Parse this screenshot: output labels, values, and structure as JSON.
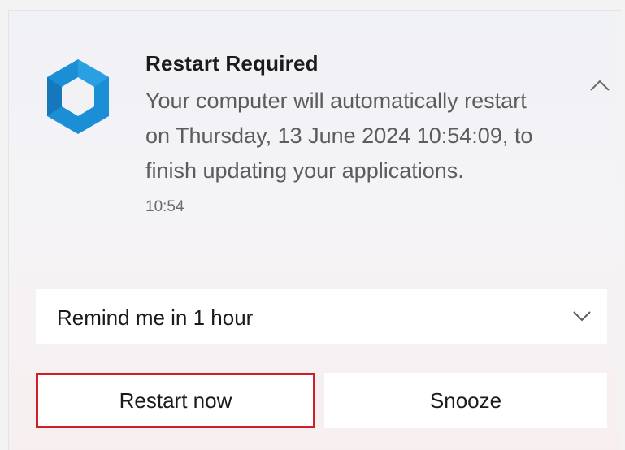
{
  "notification": {
    "title": "Restart Required",
    "message": "Your computer will automatically restart on  Thursday, 13 June 2024 10:54:09, to finish updating your applications.",
    "time": "10:54",
    "app_icon": "app-logo-icon",
    "collapse_icon": "chevron-up-icon"
  },
  "reminder": {
    "selected": "Remind me in 1 hour",
    "chevron_icon": "chevron-down-icon"
  },
  "actions": {
    "restart_label": "Restart now",
    "snooze_label": "Snooze"
  },
  "colors": {
    "accent": "#1a8fd6",
    "highlight_border": "#d01f26",
    "text_primary": "#1b1b1b",
    "text_secondary": "#5c5c5c"
  }
}
